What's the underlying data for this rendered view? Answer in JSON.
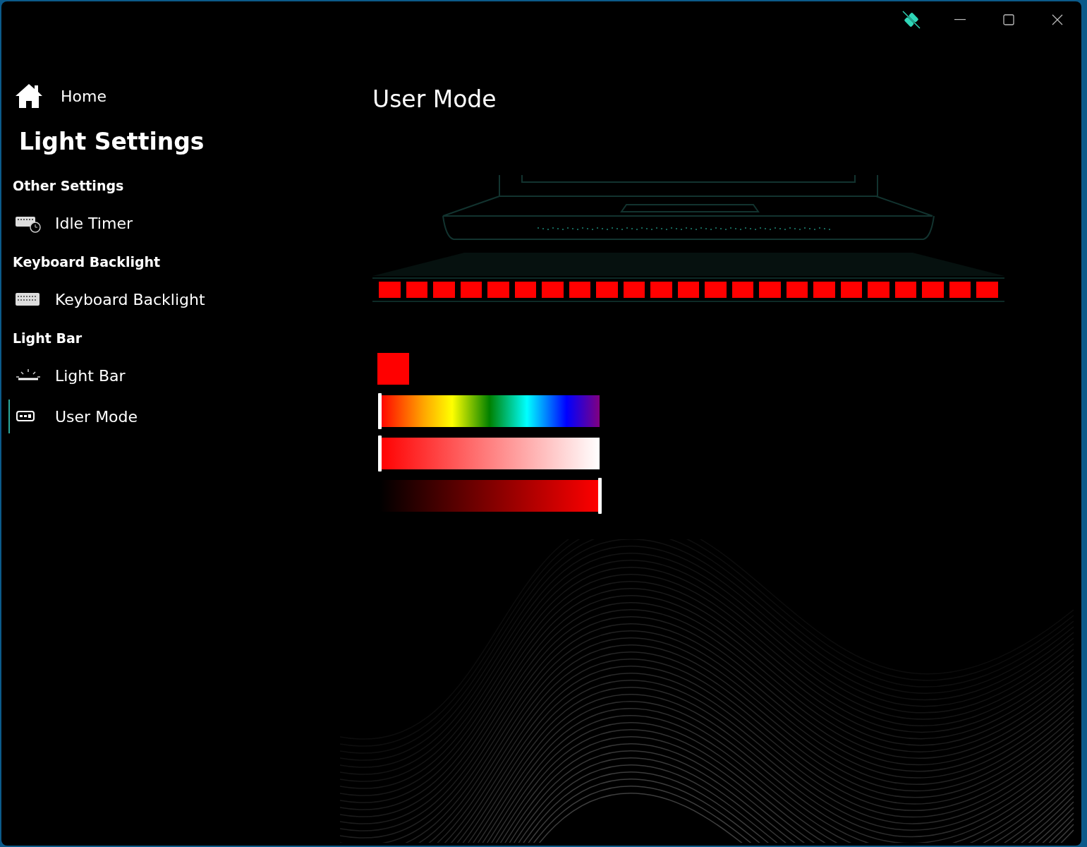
{
  "sidebar": {
    "home": {
      "label": "Home"
    },
    "title": "Light Settings",
    "sections": [
      {
        "header": "Other Settings",
        "items": [
          {
            "label": "Idle Timer",
            "kind": "timer",
            "selected": false
          }
        ]
      },
      {
        "header": "Keyboard Backlight",
        "items": [
          {
            "label": "Keyboard Backlight",
            "kind": "keyboard",
            "selected": false
          }
        ]
      },
      {
        "header": "Light Bar",
        "items": [
          {
            "label": "Light Bar",
            "kind": "lightbar",
            "selected": false
          },
          {
            "label": "User Mode",
            "kind": "usermode",
            "selected": true
          }
        ]
      }
    ]
  },
  "page": {
    "title": "User Mode",
    "light_bar": {
      "segments": [
        {
          "color": "#ff0000"
        },
        {
          "color": "#ff0000"
        },
        {
          "color": "#ff0000"
        },
        {
          "color": "#ff0000"
        },
        {
          "color": "#ff0000"
        },
        {
          "color": "#ff0000"
        },
        {
          "color": "#ff0000"
        },
        {
          "color": "#ff0000"
        },
        {
          "color": "#ff0000"
        },
        {
          "color": "#ff0000"
        },
        {
          "color": "#ff0000"
        },
        {
          "color": "#ff0000"
        },
        {
          "color": "#ff0000"
        },
        {
          "color": "#ff0000"
        },
        {
          "color": "#ff0000"
        },
        {
          "color": "#ff0000"
        },
        {
          "color": "#ff0000"
        },
        {
          "color": "#ff0000"
        },
        {
          "color": "#ff0000"
        },
        {
          "color": "#ff0000"
        },
        {
          "color": "#ff0000"
        },
        {
          "color": "#ff0000"
        },
        {
          "color": "#ff0000"
        }
      ]
    },
    "swatch": {
      "color": "#ff0000"
    },
    "sliders": [
      {
        "kind": "hue",
        "level": 0
      },
      {
        "kind": "saturation",
        "level": 0
      },
      {
        "kind": "brightness",
        "level": 1
      }
    ]
  }
}
